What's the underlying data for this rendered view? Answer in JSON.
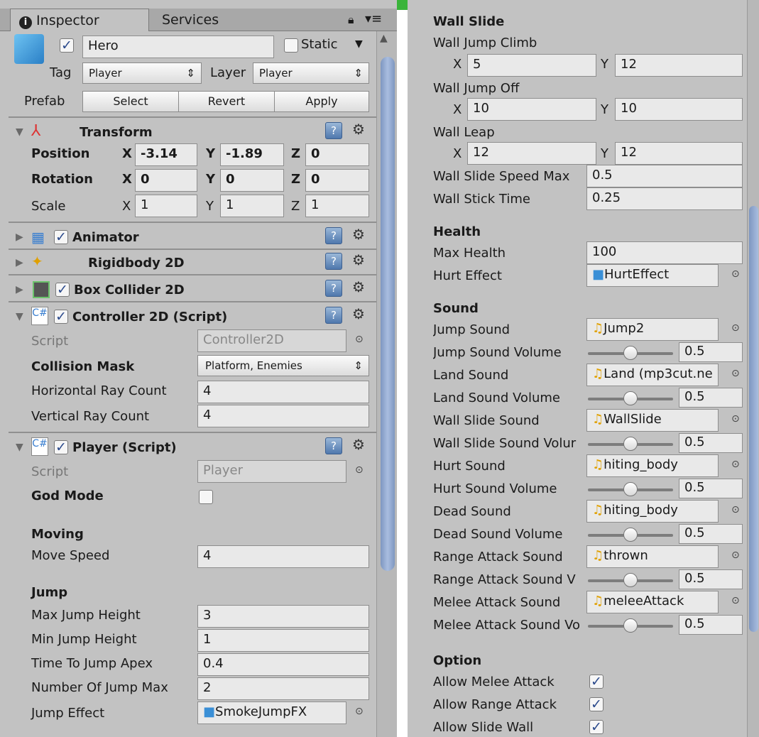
{
  "tabs": {
    "inspector": "Inspector",
    "services": "Services"
  },
  "object": {
    "name": "Hero",
    "static_label": "Static",
    "tag_label": "Tag",
    "tag_value": "Player",
    "layer_label": "Layer",
    "layer_value": "Player",
    "prefab_label": "Prefab",
    "select": "Select",
    "revert": "Revert",
    "apply": "Apply"
  },
  "transform": {
    "title": "Transform",
    "position": "Position",
    "rotation": "Rotation",
    "scale": "Scale",
    "pos": {
      "x": "-3.14",
      "y": "-1.89",
      "z": "0"
    },
    "rot": {
      "x": "0",
      "y": "0",
      "z": "0"
    },
    "scl": {
      "x": "1",
      "y": "1",
      "z": "1"
    },
    "x": "X",
    "y": "Y",
    "z": "Z"
  },
  "components": {
    "animator": "Animator",
    "rigidbody": "Rigidbody 2D",
    "boxcollider": "Box Collider 2D"
  },
  "controller": {
    "title": "Controller 2D (Script)",
    "script_label": "Script",
    "script_value": "Controller2D",
    "mask_label": "Collision Mask",
    "mask_value": "Platform, Enemies",
    "hray_label": "Horizontal Ray Count",
    "hray_value": "4",
    "vray_label": "Vertical Ray Count",
    "vray_value": "4"
  },
  "player": {
    "title": "Player (Script)",
    "script_label": "Script",
    "script_value": "Player",
    "god_label": "God Mode",
    "moving": "Moving",
    "move_speed_label": "Move Speed",
    "move_speed": "4",
    "jump": "Jump",
    "max_jump_label": "Max Jump Height",
    "max_jump": "3",
    "min_jump_label": "Min Jump Height",
    "min_jump": "1",
    "apex_label": "Time To Jump Apex",
    "apex": "0.4",
    "jump_max_label": "Number Of Jump Max",
    "jump_max": "2",
    "jump_effect_label": "Jump Effect",
    "jump_effect": "SmokeJumpFX"
  },
  "wall": {
    "title": "Wall Slide",
    "climb": "Wall Jump Climb",
    "climb_x": "5",
    "climb_y": "12",
    "off": "Wall Jump Off",
    "off_x": "10",
    "off_y": "10",
    "leap": "Wall Leap",
    "leap_x": "12",
    "leap_y": "12",
    "speed_label": "Wall Slide Speed Max",
    "speed": "0.5",
    "stick_label": "Wall Stick Time",
    "stick": "0.25",
    "x": "X",
    "y": "Y"
  },
  "health": {
    "title": "Health",
    "max_label": "Max Health",
    "max": "100",
    "hurt_label": "Hurt Effect",
    "hurt": "HurtEffect"
  },
  "sound": {
    "title": "Sound",
    "rows": [
      {
        "label": "Jump Sound",
        "value": "Jump2"
      },
      {
        "label": "Jump Sound Volume",
        "value": "0.5"
      },
      {
        "label": "Land Sound",
        "value": "Land (mp3cut.ne"
      },
      {
        "label": "Land Sound Volume",
        "value": "0.5"
      },
      {
        "label": "Wall Slide Sound",
        "value": "WallSlide"
      },
      {
        "label": "Wall Slide Sound Volur",
        "value": "0.5"
      },
      {
        "label": "Hurt Sound",
        "value": "hiting_body"
      },
      {
        "label": "Hurt Sound Volume",
        "value": "0.5"
      },
      {
        "label": "Dead Sound",
        "value": "hiting_body"
      },
      {
        "label": "Dead Sound Volume",
        "value": "0.5"
      },
      {
        "label": "Range Attack Sound",
        "value": "thrown"
      },
      {
        "label": "Range Attack Sound V",
        "value": "0.5"
      },
      {
        "label": "Melee Attack Sound",
        "value": "meleeAttack"
      },
      {
        "label": "Melee Attack Sound Vo",
        "value": "0.5"
      }
    ]
  },
  "option": {
    "title": "Option",
    "melee": "Allow Melee Attack",
    "range": "Allow Range Attack",
    "slide": "Allow Slide Wall"
  },
  "icons": {
    "info": "info-icon",
    "lock": "lock-icon",
    "menu": "menu-icon",
    "gear": "gear-icon",
    "help": "help-icon",
    "picker": "object-picker-icon"
  }
}
